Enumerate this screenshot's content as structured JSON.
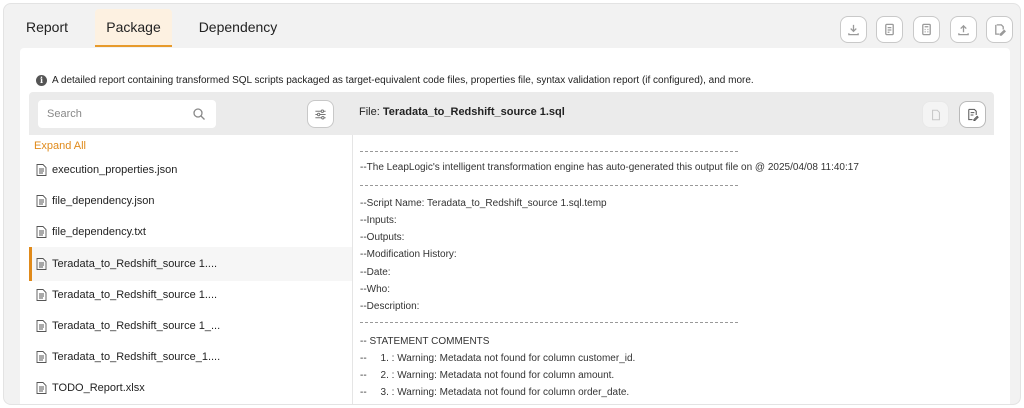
{
  "tabs": [
    {
      "label": "Report",
      "active": false
    },
    {
      "label": "Package",
      "active": true
    },
    {
      "label": "Dependency",
      "active": false
    }
  ],
  "toolbar": {
    "icons": [
      "download-icon",
      "report-icon",
      "calculator-icon",
      "upload-icon",
      "edit-icon"
    ]
  },
  "info_text": "A detailed report containing transformed SQL scripts packaged as target-equivalent code files, properties file, syntax validation report (if configured), and more.",
  "search": {
    "placeholder": "Search",
    "value": ""
  },
  "file_header": {
    "prefix": "File:",
    "name": "Teradata_to_Redshift_source 1.sql"
  },
  "expand_all": "Expand All",
  "files": [
    {
      "name": "execution_properties.json"
    },
    {
      "name": "file_dependency.json"
    },
    {
      "name": "file_dependency.txt"
    },
    {
      "name": "Teradata_to_Redshift_source 1....",
      "selected": true
    },
    {
      "name": "Teradata_to_Redshift_source 1...."
    },
    {
      "name": "Teradata_to_Redshift_source 1_..."
    },
    {
      "name": "Teradata_to_Redshift_source_1...."
    },
    {
      "name": "TODO_Report.xlsx"
    }
  ],
  "code_lines": [
    "--The LeapLogic's intelligent transformation engine has auto-generated this output file on @ 2025/04/08 11:40:17",
    "--Script Name: Teradata_to_Redshift_source 1.sql.temp",
    "--Inputs:",
    "--Outputs:",
    "--Modification History:",
    "--Date:",
    "--Who:",
    "--Description:",
    "-- STATEMENT COMMENTS",
    "--     1. : Warning: Metadata not found for column customer_id.",
    "--     2. : Warning: Metadata not found for column amount.",
    "--     3. : Warning: Metadata not found for column order_date."
  ],
  "colors": {
    "accent": "#e08a1a",
    "active_tab_bg": "#fdf1e1"
  }
}
